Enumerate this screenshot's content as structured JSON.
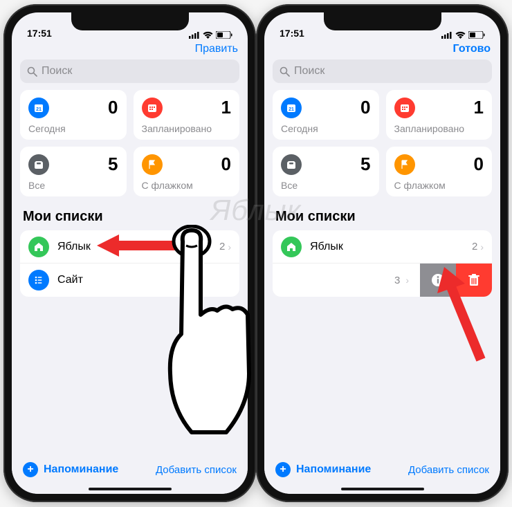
{
  "watermark": "Яблык",
  "status": {
    "time": "17:51"
  },
  "left": {
    "nav_action": "Править",
    "search_placeholder": "Поиск",
    "cards": [
      {
        "id": "today",
        "label": "Сегодня",
        "count": "0",
        "color": "#007aff",
        "icon": "calendar-icon"
      },
      {
        "id": "scheduled",
        "label": "Запланировано",
        "count": "1",
        "color": "#ff3b30",
        "icon": "calendar-grid-icon"
      },
      {
        "id": "all",
        "label": "Все",
        "count": "5",
        "color": "#5b6065",
        "icon": "tray-icon"
      },
      {
        "id": "flagged",
        "label": "С флажком",
        "count": "0",
        "color": "#ff9500",
        "icon": "flag-icon"
      }
    ],
    "section_title": "Мои списки",
    "lists": [
      {
        "id": "yablyk",
        "label": "Яблык",
        "count": "2",
        "color": "#34c759",
        "icon": "home-icon"
      },
      {
        "id": "site",
        "label": "Сайт",
        "count": "",
        "color": "#007aff",
        "icon": "list-icon"
      }
    ],
    "new_reminder": "Напоминание",
    "add_list": "Добавить список"
  },
  "right": {
    "nav_action": "Готово",
    "search_placeholder": "Поиск",
    "cards": [
      {
        "id": "today",
        "label": "Сегодня",
        "count": "0",
        "color": "#007aff",
        "icon": "calendar-icon"
      },
      {
        "id": "scheduled",
        "label": "Запланировано",
        "count": "1",
        "color": "#ff3b30",
        "icon": "calendar-grid-icon"
      },
      {
        "id": "all",
        "label": "Все",
        "count": "5",
        "color": "#5b6065",
        "icon": "tray-icon"
      },
      {
        "id": "flagged",
        "label": "С флажком",
        "count": "0",
        "color": "#ff9500",
        "icon": "flag-icon"
      }
    ],
    "section_title": "Мои списки",
    "lists": [
      {
        "id": "yablyk",
        "label": "Яблык",
        "count": "2",
        "color": "#34c759",
        "icon": "home-icon"
      },
      {
        "id": "site",
        "label": "",
        "count": "3",
        "color": "#007aff",
        "icon": "list-icon",
        "swiped": true
      }
    ],
    "new_reminder": "Напоминание",
    "add_list": "Добавить список"
  }
}
